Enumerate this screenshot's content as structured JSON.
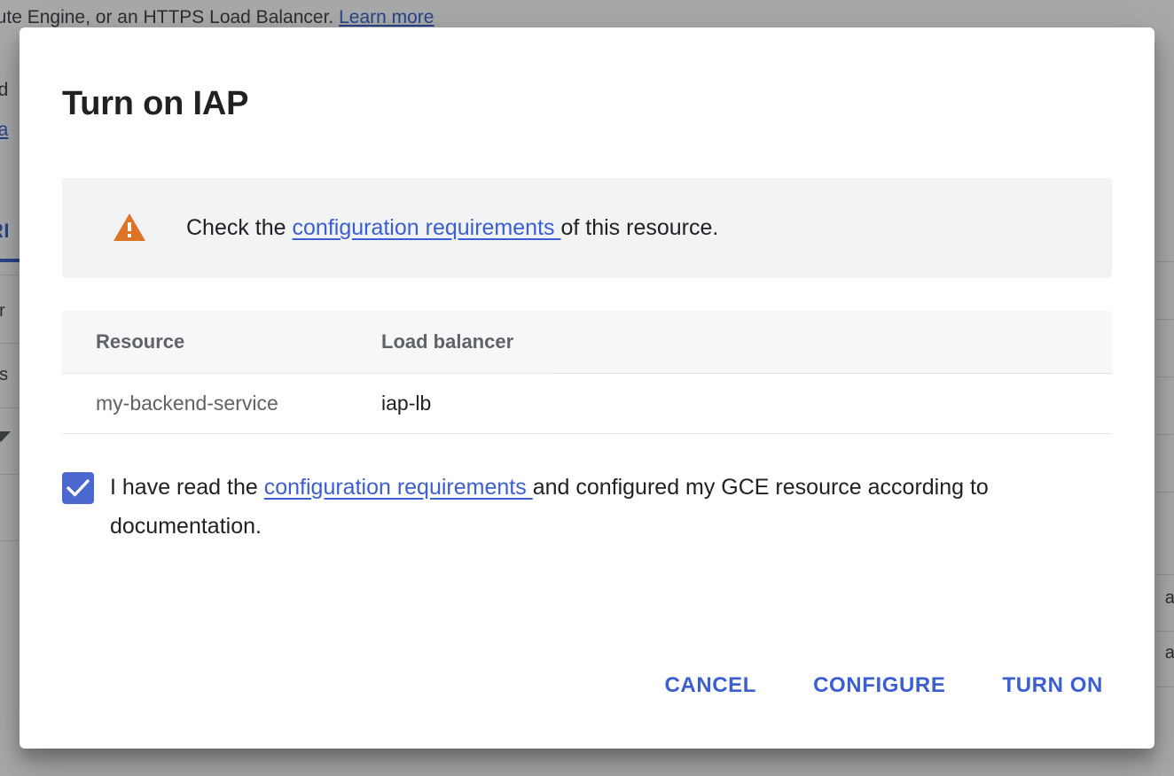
{
  "background": {
    "top_text_before_link": "pute Engine, or an HTTPS Load Balancer.",
    "top_link": "Learn more",
    "fragment_ed": "ed",
    "fragment_pa": "pa",
    "tab_label": "RI",
    "fragment_er": "er",
    "fragment_es": "es",
    "right_fragment_1": "an",
    "right_fragment_2": "an",
    "caret_icon": "caret-down-icon"
  },
  "dialog": {
    "title": "Turn on IAP",
    "warning": {
      "icon": "warning-triangle-icon",
      "text_before_link": "Check the ",
      "link": "configuration requirements ",
      "text_after_link": "of this resource."
    },
    "table": {
      "columns": [
        "Resource",
        "Load balancer",
        ""
      ],
      "rows": [
        {
          "resource": "my-backend-service",
          "load_balancer": "iap-lb",
          "spacer": ""
        }
      ]
    },
    "acknowledgement": {
      "checked": true,
      "checkmark_icon": "check-icon",
      "text_before_link": "I have read the ",
      "link": "configuration requirements ",
      "text_after_link": "and configured my GCE resource according to documentation."
    },
    "actions": {
      "cancel": "CANCEL",
      "configure": "CONFIGURE",
      "turn_on": "TURN ON"
    }
  },
  "colors": {
    "link": "#3b5ed0",
    "warning": "#dd7326",
    "checkbox": "#4a68cf",
    "header_text": "#5f6368",
    "body_text": "#202124"
  }
}
